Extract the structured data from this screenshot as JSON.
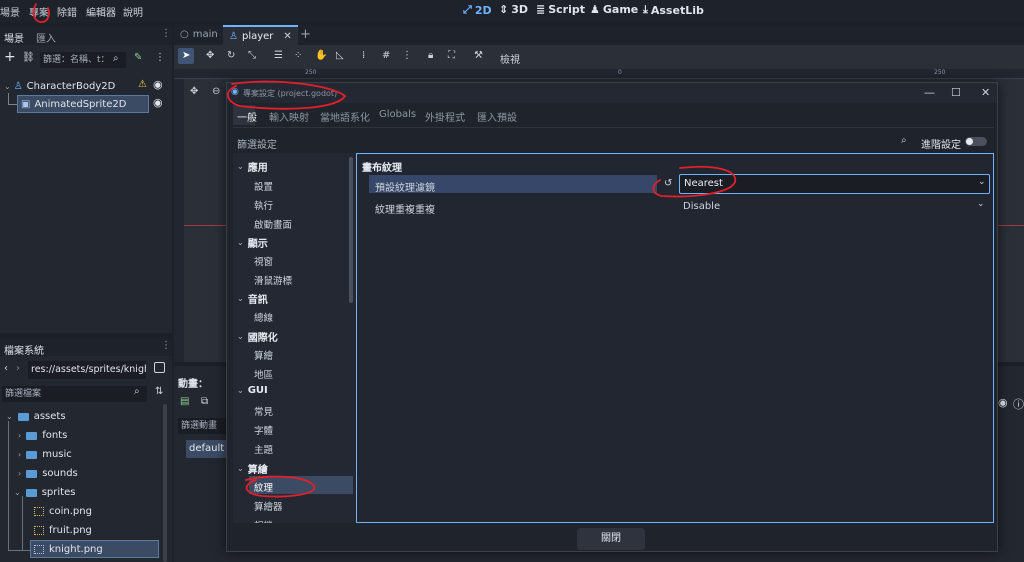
{
  "menu": {
    "items": [
      "場景",
      "專案",
      "除錯",
      "編輯器",
      "說明"
    ],
    "modes": [
      {
        "label": "2D",
        "icon": "2d-icon",
        "active": true
      },
      {
        "label": "3D",
        "icon": "3d-icon",
        "active": false
      },
      {
        "label": "Script",
        "icon": "script-icon",
        "active": false
      },
      {
        "label": "Game",
        "icon": "game-icon",
        "active": false
      },
      {
        "label": "AssetLib",
        "icon": "assetlib-icon",
        "active": false
      }
    ]
  },
  "scene_dock": {
    "tabs": [
      "場景",
      "匯入"
    ],
    "filter_placeholder": "篩選：名稱、t：",
    "nodes": [
      {
        "label": "CharacterBody2D",
        "icon": "characterbody-icon",
        "warning": true
      },
      {
        "label": "AnimatedSprite2D",
        "icon": "animatedsprite-icon",
        "selected": true
      }
    ]
  },
  "fs_dock": {
    "title": "檔案系統",
    "path": "res://assets/sprites/knight",
    "filter_placeholder": "篩選檔案",
    "tree": [
      {
        "label": "assets",
        "type": "folder",
        "depth": 0
      },
      {
        "label": "fonts",
        "type": "folder",
        "depth": 1
      },
      {
        "label": "music",
        "type": "folder",
        "depth": 1
      },
      {
        "label": "sounds",
        "type": "folder",
        "depth": 1
      },
      {
        "label": "sprites",
        "type": "folder",
        "depth": 1
      },
      {
        "label": "coin.png",
        "type": "file",
        "depth": 2
      },
      {
        "label": "fruit.png",
        "type": "file",
        "depth": 2
      },
      {
        "label": "knight.png",
        "type": "file",
        "depth": 2,
        "selected": true
      }
    ]
  },
  "editor": {
    "tabs": [
      {
        "label": "main"
      },
      {
        "label": "player",
        "active": true
      }
    ],
    "view_label": "檢視",
    "ruler_labels": [
      "250",
      "0",
      "250"
    ]
  },
  "anim_panel": {
    "title": "動畫：",
    "filter": "篩選動畫",
    "default_anim": "default"
  },
  "dialog": {
    "title": "專案設定 (project.godot)",
    "tabs": [
      "一般",
      "輸入映射",
      "當地語系化",
      "Globals",
      "外掛程式",
      "匯入預設"
    ],
    "filter_label": "篩選設定",
    "advanced_label": "進階設定",
    "categories": [
      {
        "head": "應用",
        "items": [
          "設置",
          "執行",
          "啟動畫面"
        ]
      },
      {
        "head": "顯示",
        "items": [
          "視窗",
          "滑鼠游標"
        ]
      },
      {
        "head": "音訊",
        "items": [
          "總線"
        ]
      },
      {
        "head": "國際化",
        "items": [
          "算繪",
          "地區"
        ]
      },
      {
        "head": "GUI",
        "items": [
          "常見",
          "字體",
          "主題"
        ]
      },
      {
        "head": "算繪",
        "items": [
          "紋理",
          "算繪器",
          "相機"
        ]
      }
    ],
    "section_title": "畫布紋理",
    "settings": [
      {
        "label": "預設紋理濾鏡",
        "value": "Nearest",
        "highlighted": true
      },
      {
        "label": "紋理重複重複",
        "value": "Disable",
        "highlighted": false
      }
    ],
    "close_label": "關閉"
  },
  "colors": {
    "accent": "#6fb3ff",
    "annotation": "#e0202a"
  }
}
